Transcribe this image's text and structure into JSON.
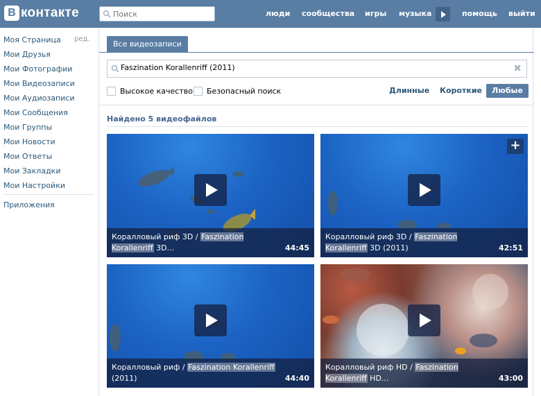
{
  "header": {
    "logo_badge": "В",
    "logo_text": "контакте",
    "search_placeholder": "Поиск",
    "nav": [
      {
        "label": "люди"
      },
      {
        "label": "сообщества"
      },
      {
        "label": "игры"
      },
      {
        "label": "музыка"
      },
      {
        "label": "помощь"
      },
      {
        "label": "выйти"
      }
    ]
  },
  "sidebar": {
    "edit_label": "ред.",
    "items": [
      {
        "label": "Моя Страница"
      },
      {
        "label": "Мои Друзья"
      },
      {
        "label": "Мои Фотографии"
      },
      {
        "label": "Мои Видеозаписи"
      },
      {
        "label": "Мои Аудиозаписи"
      },
      {
        "label": "Мои Сообщения"
      },
      {
        "label": "Мои Группы"
      },
      {
        "label": "Мои Новости"
      },
      {
        "label": "Мои Ответы"
      },
      {
        "label": "Мои Закладки"
      },
      {
        "label": "Мои Настройки"
      }
    ],
    "apps_label": "Приложения"
  },
  "main": {
    "tab_label": "Все видеозаписи",
    "search_value": "Faszination Korallenriff (2011)",
    "checkboxes": [
      {
        "label": "Высокое качество"
      },
      {
        "label": "Безопасный поиск"
      }
    ],
    "filters": [
      {
        "label": "Длинные"
      },
      {
        "label": "Короткие"
      },
      {
        "label": "Любые",
        "active": true
      }
    ],
    "results_label": "Найдено 5 видеофайлов",
    "videos": [
      {
        "title_pre": "Коралловый риф 3D / ",
        "title_hl": "Faszination Korallenriff",
        "title_post": " 3D...",
        "duration": "44:45"
      },
      {
        "title_pre": "Коралловый риф 3D / ",
        "title_hl": "Faszination Korallenriff",
        "title_post": " 3D (2011)",
        "duration": "42:51"
      },
      {
        "title_pre": "Коралловый риф / ",
        "title_hl": "Faszination Korallenriff",
        "title_post": " (2011)",
        "duration": "44:40"
      },
      {
        "title_pre": "Коралловый риф HD / ",
        "title_hl": "Faszination Korallenriff",
        "title_post": " HD...",
        "duration": "43:00"
      }
    ],
    "add_label": "+"
  },
  "colors": {
    "brand": "#597da3",
    "link": "#2b587a",
    "water": "#1c63c4"
  }
}
